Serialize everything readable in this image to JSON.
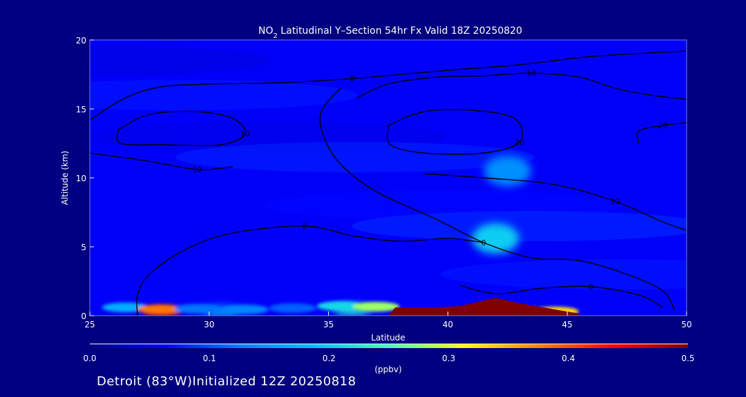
{
  "chart_data": {
    "type": "heatmap",
    "title_pre": "NO",
    "title_sub": "2",
    "title_post": " Latitudinal Y–Section 54hr  Fx Valid 18Z 20250820",
    "xlabel": "Latitude",
    "ylabel": "Altitude (km)",
    "xlim": [
      25,
      50
    ],
    "ylim": [
      0,
      20
    ],
    "xticks": [
      "25",
      "30",
      "35",
      "40",
      "45",
      "50"
    ],
    "yticks": [
      "0",
      "5",
      "10",
      "15",
      "20"
    ],
    "colorbar": {
      "label": "(ppbv)",
      "range": [
        0,
        0.5
      ],
      "ticks": [
        "0.0",
        "0.1",
        "0.2",
        "0.3",
        "0.4",
        "0.5"
      ],
      "colors": [
        "#000080",
        "#0000ff",
        "#0080ff",
        "#00c0ff",
        "#40ffc0",
        "#ffff00",
        "#ff8000",
        "#ff0000",
        "#800000"
      ]
    },
    "background_level": 0.06,
    "features": [
      {
        "lat": 42.0,
        "alt": 5.6,
        "value": 0.2
      },
      {
        "lat": 42.5,
        "alt": 10.5,
        "value": 0.14
      },
      {
        "lat": 28.0,
        "alt": 0.2,
        "value": 0.45
      },
      {
        "lat": 36.0,
        "alt": 0.4,
        "value": 0.22
      },
      {
        "lat": 30.5,
        "alt": 0.3,
        "value": 0.15
      }
    ],
    "high_region": {
      "value": 0.5,
      "points": [
        [
          37.5,
          0
        ],
        [
          37.8,
          0.6
        ],
        [
          39.5,
          0.6
        ],
        [
          40.5,
          0.7
        ],
        [
          42.0,
          1.3
        ],
        [
          43.0,
          0.9
        ],
        [
          45.5,
          0.15
        ],
        [
          45.5,
          0
        ]
      ]
    },
    "contour_labels": [
      "0",
      "10",
      "20"
    ],
    "contours": [
      {
        "label": "0",
        "points": [
          [
            25,
            14.2
          ],
          [
            26.5,
            15.8
          ],
          [
            28,
            16.6
          ],
          [
            30,
            16.8
          ],
          [
            33,
            16.9
          ],
          [
            36,
            17.2
          ],
          [
            40,
            17.8
          ],
          [
            43,
            18.2
          ],
          [
            46,
            18.8
          ],
          [
            50,
            19.2
          ]
        ]
      },
      {
        "label": "0",
        "points": [
          [
            35.5,
            16.5
          ],
          [
            34.7,
            14.8
          ],
          [
            34.8,
            13.0
          ],
          [
            35.5,
            11.0
          ],
          [
            37.0,
            9.0
          ],
          [
            39.5,
            7.0
          ],
          [
            41.5,
            5.3
          ],
          [
            43.5,
            4.2
          ],
          [
            45.5,
            4.0
          ],
          [
            47.5,
            3.0
          ],
          [
            49.0,
            1.8
          ],
          [
            49.5,
            0.4
          ]
        ]
      },
      {
        "label": "0",
        "points": [
          [
            27.0,
            0.0
          ],
          [
            27.0,
            1.5
          ],
          [
            27.5,
            3.0
          ],
          [
            29.0,
            4.8
          ],
          [
            31.0,
            6.0
          ],
          [
            34.0,
            6.5
          ],
          [
            36.0,
            5.8
          ],
          [
            38.0,
            5.4
          ],
          [
            40.0,
            5.6
          ],
          [
            41.5,
            5.3
          ]
        ]
      },
      {
        "label": "0",
        "points": [
          [
            40.5,
            2.2
          ],
          [
            42.0,
            1.6
          ],
          [
            44.0,
            2.0
          ],
          [
            46.0,
            2.1
          ],
          [
            48.0,
            1.5
          ],
          [
            49.0,
            0.6
          ]
        ]
      },
      {
        "label": "10",
        "points": [
          [
            26.2,
            13.5
          ],
          [
            27.5,
            14.6
          ],
          [
            29.5,
            14.8
          ],
          [
            31.0,
            14.3
          ],
          [
            31.5,
            13.2
          ],
          [
            30.5,
            12.4
          ],
          [
            28.0,
            12.4
          ],
          [
            26.3,
            12.5
          ],
          [
            26.2,
            13.5
          ]
        ]
      },
      {
        "label": "10",
        "points": [
          [
            36.2,
            15.8
          ],
          [
            37.5,
            16.8
          ],
          [
            39.5,
            17.3
          ],
          [
            41.5,
            17.4
          ],
          [
            43.5,
            17.6
          ],
          [
            45.5,
            17.3
          ],
          [
            47.0,
            16.5
          ],
          [
            48.5,
            16.0
          ],
          [
            50,
            15.7
          ]
        ]
      },
      {
        "label": "10",
        "points": [
          [
            39.0,
            10.3
          ],
          [
            41.5,
            10.0
          ],
          [
            44.5,
            9.5
          ],
          [
            47.0,
            8.3
          ],
          [
            49.0,
            6.8
          ],
          [
            50,
            6.2
          ]
        ]
      },
      {
        "label": "10",
        "points": [
          [
            25,
            11.8
          ],
          [
            27.5,
            11.2
          ],
          [
            29.5,
            10.6
          ],
          [
            31.0,
            10.8
          ]
        ]
      },
      {
        "label": "20",
        "points": [
          [
            37.5,
            13.8
          ],
          [
            39.0,
            14.8
          ],
          [
            41.0,
            14.9
          ],
          [
            42.8,
            14.3
          ],
          [
            43.0,
            12.6
          ],
          [
            41.5,
            11.8
          ],
          [
            39.0,
            11.8
          ],
          [
            37.6,
            12.4
          ],
          [
            37.5,
            13.8
          ]
        ]
      },
      {
        "label": "20",
        "points": [
          [
            48.0,
            12.5
          ],
          [
            48.0,
            13.4
          ],
          [
            49.0,
            13.8
          ],
          [
            50,
            14.0
          ]
        ]
      }
    ]
  },
  "footer": "Detroit (83°W)Initialized 12Z 20250818"
}
